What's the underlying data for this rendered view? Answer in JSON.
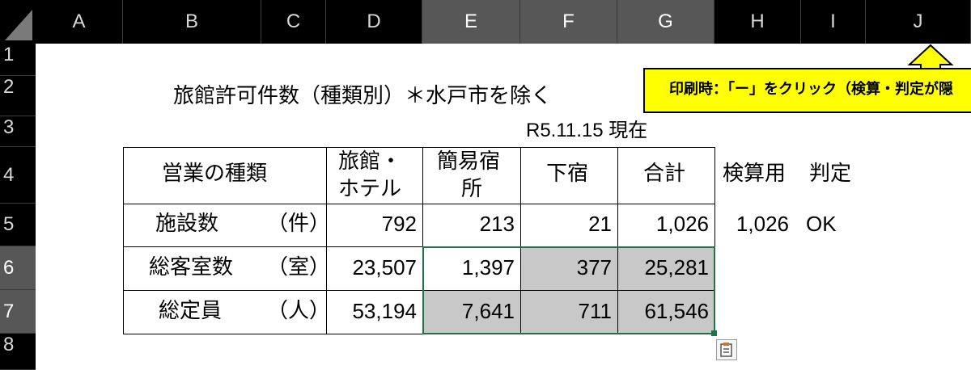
{
  "columns": [
    "A",
    "B",
    "C",
    "D",
    "E",
    "F",
    "G",
    "H",
    "I",
    "J"
  ],
  "rows": [
    "1",
    "2",
    "3",
    "4",
    "5",
    "6",
    "7",
    "8"
  ],
  "title": "旅館許可件数（種類別）＊水戸市を除く",
  "date_label": "R5.11.15 現在",
  "note": "印刷時：「ー」をクリック（検算・判定が隠",
  "table": {
    "header": {
      "type": "営業の種類",
      "ryokan_line1": "旅館・",
      "ryokan_line2": "ホテル",
      "kani_line1": "簡易宿",
      "kani_line2": "所",
      "geshuku": "下宿",
      "total": "合計"
    },
    "rows": [
      {
        "label": "施設数",
        "unit": "（件）",
        "ryokan": "792",
        "kani": "213",
        "geshuku": "21",
        "total": "1,026"
      },
      {
        "label": "総客室数",
        "unit": "（室）",
        "ryokan": "23,507",
        "kani": "1,397",
        "geshuku": "377",
        "total": "25,281"
      },
      {
        "label": "総定員",
        "unit": "（人）",
        "ryokan": "53,194",
        "kani": "7,641",
        "geshuku": "711",
        "total": "61,546"
      }
    ]
  },
  "check": {
    "header_check": "検算用",
    "header_judge": "判定",
    "value": "1,026",
    "result": "OK"
  }
}
